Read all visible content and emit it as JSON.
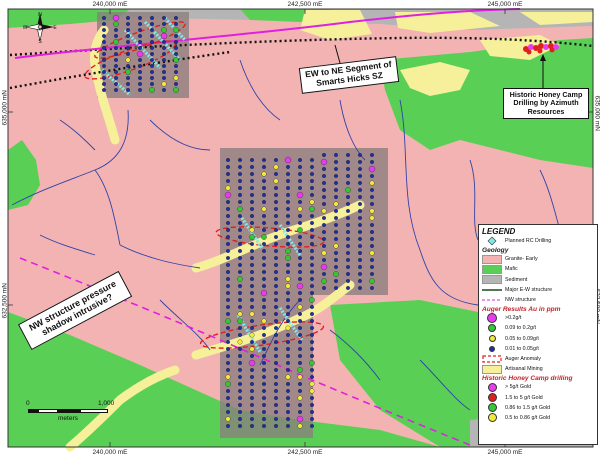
{
  "map": {
    "grid_labels": {
      "easting_top": [
        "240,000 mE",
        "242,500 mE",
        "245,000 mE"
      ],
      "easting_bottom": [
        "240,000 mE",
        "242,500 mE",
        "245,000 mE"
      ],
      "northing_left": [
        "635,000 mN",
        "632,500 mN"
      ],
      "northing_right": [
        "635,000 mN",
        "632,500 mN"
      ]
    },
    "north_arrow": {
      "n": "N",
      "s": "S",
      "e": "E",
      "w": "W"
    },
    "callouts": {
      "ew_segment": "EW to NE Segment of Smarts Hicks SZ",
      "nw_structure": "NW structure pressure shadow intrusive?",
      "honey_camp": "Historic Honey Camp Drilling by Azimuth Resources"
    },
    "scale_bar": {
      "zero": "0",
      "max": "1,000",
      "unit": "meters"
    },
    "colors": {
      "granite": "#f3b3b3",
      "mafic": "#59d055",
      "sediment": "#b5b5b5",
      "artisanal": "#f6f09a",
      "drainage": "#2f43a8",
      "auger_anomaly": "#e02020",
      "nw_structure": "#e020e0",
      "planned_rc": "#7fe8e8"
    }
  },
  "legend": {
    "title": "LEGEND",
    "planned": "Planned RC Drilling",
    "geology_head": "Geology",
    "geology": [
      {
        "label": "Granite- Early",
        "color": "#f3b3b3"
      },
      {
        "label": "Mafic",
        "color": "#59d055"
      },
      {
        "label": "Sediment",
        "color": "#b5b5b5"
      }
    ],
    "structures": [
      {
        "label": "Major E-W structure"
      },
      {
        "label": "NW structure"
      }
    ],
    "auger_head": "Auger Results Au in ppm",
    "auger": [
      {
        "label": ">0.2g/t",
        "color": "#e63cf0",
        "size": 9
      },
      {
        "label": "0.09 to 0.2g/t",
        "color": "#34c934",
        "size": 7
      },
      {
        "label": "0.05 to 0.09g/t",
        "color": "#f2ea3a",
        "size": 6
      },
      {
        "label": "0.01 to 0.05g/t",
        "color": "#1f2fa6",
        "size": 4
      }
    ],
    "auger_anomaly": "Auger Anomaly",
    "artisanal": "Artisanal Mining",
    "hc_head": "Historic Honey Camp drilling",
    "hc": [
      {
        "label": "> 5g/t Gold",
        "color": "#e63cf0"
      },
      {
        "label": "1.5 to 5 g/t Gold",
        "color": "#e02020"
      },
      {
        "label": "0.86 to 1.5 g/t Gold",
        "color": "#34c934"
      },
      {
        "label": "0.5 to 0.86 g/t Gold",
        "color": "#f2ea3a"
      }
    ]
  }
}
